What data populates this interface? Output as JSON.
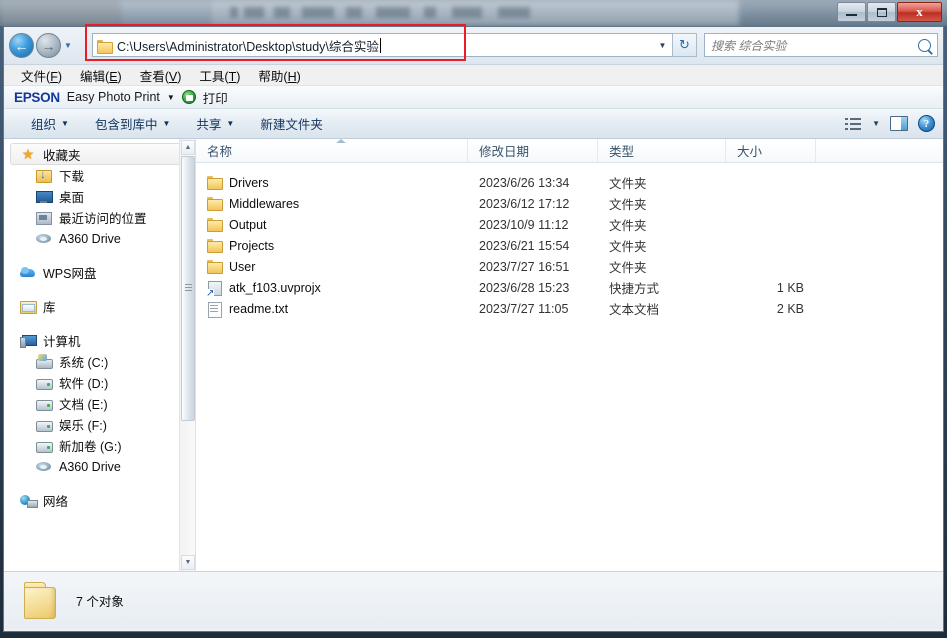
{
  "window": {
    "controls": {
      "minimize": "–",
      "maximize": "▫",
      "close": "✕"
    }
  },
  "address_bar": {
    "back_icon": "←",
    "forward_icon": "→",
    "history_caret": "▼",
    "path": "C:\\Users\\Administrator\\Desktop\\study\\综合实验",
    "dropdown_caret": "▼",
    "refresh_icon": "↻",
    "folder_icon": "folder-icon"
  },
  "search": {
    "placeholder": "搜索 综合实验",
    "icon": "search-icon"
  },
  "menu": [
    {
      "label": "文件(F)",
      "text": "文件",
      "accel": "F"
    },
    {
      "label": "编辑(E)",
      "text": "编辑",
      "accel": "E"
    },
    {
      "label": "查看(V)",
      "text": "查看",
      "accel": "V"
    },
    {
      "label": "工具(T)",
      "text": "工具",
      "accel": "T"
    },
    {
      "label": "帮助(H)",
      "text": "帮助",
      "accel": "H"
    }
  ],
  "epson_bar": {
    "logo": "EPSON",
    "product": "Easy Photo Print",
    "caret": "▼",
    "print_label": "打印",
    "print_icon": "printer-icon"
  },
  "toolbar": {
    "items": [
      {
        "label": "组织",
        "caret": "▼"
      },
      {
        "label": "包含到库中",
        "caret": "▼"
      },
      {
        "label": "共享",
        "caret": "▼"
      },
      {
        "label": "新建文件夹",
        "caret": ""
      }
    ],
    "view_caret": "▼",
    "view_icon": "list-view-icon",
    "preview_icon": "preview-pane-icon",
    "help_icon": "help-icon",
    "help_glyph": "?"
  },
  "sidebar": {
    "groups": [
      {
        "header": {
          "label": "收藏夹",
          "icon": "star-icon",
          "selected": true
        },
        "children": [
          {
            "label": "下载",
            "icon": "download-folder-icon"
          },
          {
            "label": "桌面",
            "icon": "desktop-monitor-icon"
          },
          {
            "label": "最近访问的位置",
            "icon": "recent-places-icon"
          },
          {
            "label": "A360 Drive",
            "icon": "a360-drive-icon"
          }
        ]
      },
      {
        "header": {
          "label": "WPS网盘",
          "icon": "wps-cloud-icon",
          "selected": false
        },
        "children": []
      },
      {
        "header": {
          "label": "库",
          "icon": "library-icon",
          "selected": false
        },
        "children": []
      },
      {
        "header": {
          "label": "计算机",
          "icon": "computer-icon",
          "selected": false
        },
        "children": [
          {
            "label": "系统 (C:)",
            "icon": "system-drive-icon"
          },
          {
            "label": "软件 (D:)",
            "icon": "drive-icon"
          },
          {
            "label": "文档 (E:)",
            "icon": "drive-icon"
          },
          {
            "label": "娱乐 (F:)",
            "icon": "drive-icon"
          },
          {
            "label": "新加卷 (G:)",
            "icon": "drive-icon"
          },
          {
            "label": "A360 Drive",
            "icon": "a360-drive-icon"
          }
        ]
      },
      {
        "header": {
          "label": "网络",
          "icon": "network-icon",
          "selected": false
        },
        "children": []
      }
    ],
    "scrollbar": {
      "up": "▲",
      "down": "▼"
    }
  },
  "filelist": {
    "columns": [
      {
        "key": "name",
        "label": "名称"
      },
      {
        "key": "date",
        "label": "修改日期"
      },
      {
        "key": "type",
        "label": "类型"
      },
      {
        "key": "size",
        "label": "大小"
      }
    ],
    "sorted_by": "名称",
    "rows": [
      {
        "name": "Drivers",
        "date": "2023/6/26 13:34",
        "type": "文件夹",
        "size": "",
        "icon": "folder-icon"
      },
      {
        "name": "Middlewares",
        "date": "2023/6/12 17:12",
        "type": "文件夹",
        "size": "",
        "icon": "folder-icon"
      },
      {
        "name": "Output",
        "date": "2023/10/9 11:12",
        "type": "文件夹",
        "size": "",
        "icon": "folder-icon"
      },
      {
        "name": "Projects",
        "date": "2023/6/21 15:54",
        "type": "文件夹",
        "size": "",
        "icon": "folder-icon"
      },
      {
        "name": "User",
        "date": "2023/7/27 16:51",
        "type": "文件夹",
        "size": "",
        "icon": "folder-icon"
      },
      {
        "name": "atk_f103.uvprojx",
        "date": "2023/6/28 15:23",
        "type": "快捷方式",
        "size": "1 KB",
        "icon": "shortcut-icon"
      },
      {
        "name": "readme.txt",
        "date": "2023/7/27 11:05",
        "type": "文本文档",
        "size": "2 KB",
        "icon": "text-file-icon"
      }
    ]
  },
  "statusbar": {
    "count_text": "7 个对象",
    "folder_icon": "folder-icon"
  },
  "colors": {
    "annotation_red": "#ec1c24",
    "epson_blue": "#13389c",
    "header_text": "#39536b"
  }
}
